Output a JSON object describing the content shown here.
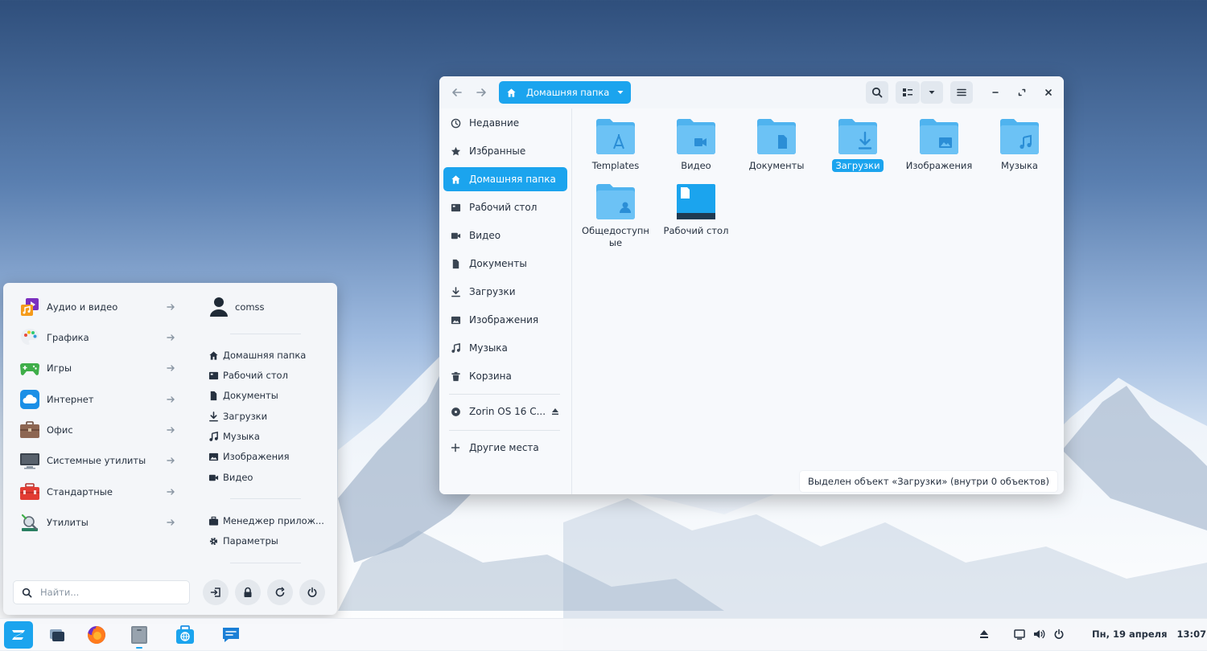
{
  "file_manager": {
    "path_label": "Домашняя папка",
    "sidebar": [
      {
        "label": "Недавние",
        "icon": "clock-icon"
      },
      {
        "label": "Избранные",
        "icon": "star-icon"
      },
      {
        "label": "Домашняя папка",
        "icon": "home-icon",
        "active": true
      },
      {
        "label": "Рабочий стол",
        "icon": "desktop-icon"
      },
      {
        "label": "Видео",
        "icon": "video-icon"
      },
      {
        "label": "Документы",
        "icon": "document-icon"
      },
      {
        "label": "Загрузки",
        "icon": "download-icon"
      },
      {
        "label": "Изображения",
        "icon": "image-icon"
      },
      {
        "label": "Музыка",
        "icon": "music-icon"
      },
      {
        "label": "Корзина",
        "icon": "trash-icon"
      }
    ],
    "device": {
      "label": "Zorin OS 16 C...",
      "icon": "disc-icon"
    },
    "other_places": "Другие места",
    "files": [
      {
        "name": "Templates",
        "icon": "templates-folder-icon"
      },
      {
        "name": "Видео",
        "icon": "video-folder-icon"
      },
      {
        "name": "Документы",
        "icon": "documents-folder-icon"
      },
      {
        "name": "Загрузки",
        "icon": "downloads-folder-icon",
        "selected": true
      },
      {
        "name": "Изображения",
        "icon": "pictures-folder-icon"
      },
      {
        "name": "Музыка",
        "icon": "music-folder-icon"
      },
      {
        "name": "Общедоступные",
        "icon": "public-folder-icon"
      },
      {
        "name": "Рабочий стол",
        "icon": "desktop-folder-icon"
      }
    ],
    "status": "Выделен объект «Загрузки»  (внутри 0 объектов)"
  },
  "start_menu": {
    "categories": [
      {
        "label": "Аудио и видео"
      },
      {
        "label": "Графика"
      },
      {
        "label": "Игры"
      },
      {
        "label": "Интернет"
      },
      {
        "label": "Офис"
      },
      {
        "label": "Системные утилиты"
      },
      {
        "label": "Стандартные"
      },
      {
        "label": "Утилиты"
      }
    ],
    "user": "comss",
    "places": [
      {
        "label": "Домашняя папка"
      },
      {
        "label": "Рабочий стол"
      },
      {
        "label": "Документы"
      },
      {
        "label": "Загрузки"
      },
      {
        "label": "Музыка"
      },
      {
        "label": "Изображения"
      },
      {
        "label": "Видео"
      }
    ],
    "apps": [
      {
        "label": "Менеджер прилож..."
      },
      {
        "label": "Параметры"
      }
    ],
    "search_placeholder": "Найти..."
  },
  "taskbar": {
    "date": "Пн, 19 апреля",
    "time": "13:07"
  },
  "colors": {
    "accent": "#1ba4ee",
    "folder": "#6cc2f5"
  }
}
